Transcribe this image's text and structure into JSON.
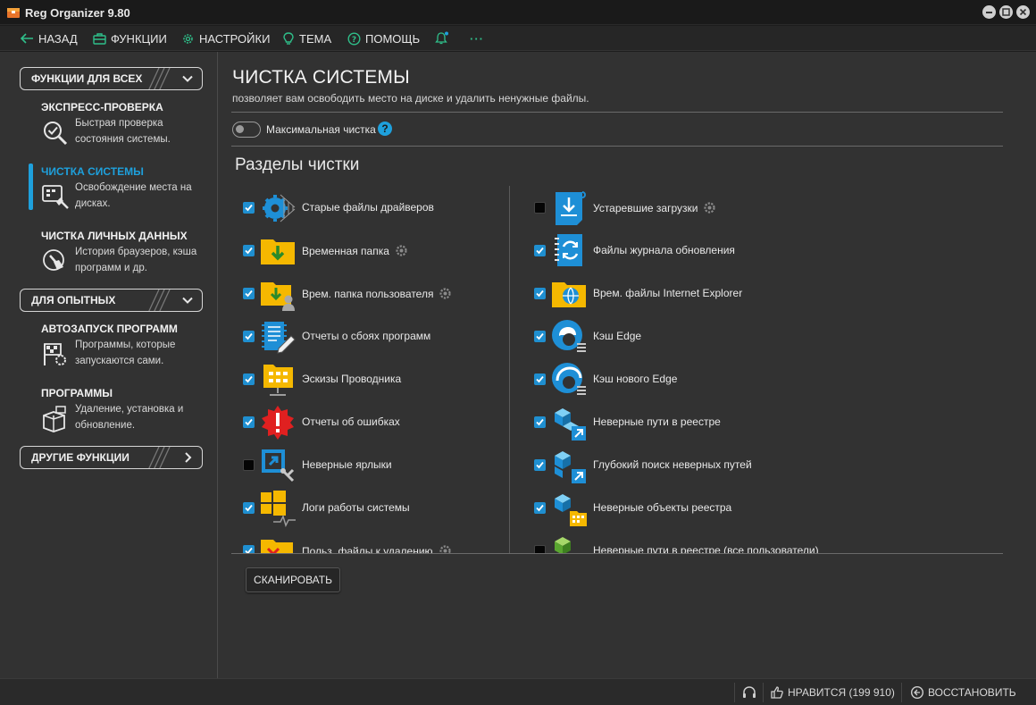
{
  "window": {
    "title": "Reg Organizer 9.80"
  },
  "toolbar": {
    "back": "НАЗАД",
    "functions": "ФУНКЦИИ",
    "settings": "НАСТРОЙКИ",
    "theme": "ТЕМА",
    "help": "ПОМОЩЬ",
    "more": "···"
  },
  "sidebar": {
    "group_all": "ФУНКЦИИ ДЛЯ ВСЕХ",
    "group_advanced": "ДЛЯ ОПЫТНЫХ",
    "group_other": "ДРУГИЕ ФУНКЦИИ",
    "items": [
      {
        "title": "ЭКСПРЕСС-ПРОВЕРКА",
        "desc": "Быстрая проверка состояния системы."
      },
      {
        "title": "ЧИСТКА СИСТЕМЫ",
        "desc": "Освобождение места на дисках."
      },
      {
        "title": "ЧИСТКА ЛИЧНЫХ ДАННЫХ",
        "desc": "История браузеров, кэша программ и др."
      },
      {
        "title": "АВТОЗАПУСК ПРОГРАММ",
        "desc": "Программы, которые запускаются сами."
      },
      {
        "title": "ПРОГРАММЫ",
        "desc": "Удаление, установка и обновление."
      }
    ]
  },
  "content": {
    "title": "ЧИСТКА СИСТЕМЫ",
    "subtitle": "позволяет вам освободить место на диске и удалить ненужные файлы.",
    "max_clean_label": "Максимальная чистка",
    "max_clean_on": false,
    "section_title": "Разделы чистки",
    "left_items": [
      {
        "label": "Старые файлы драйверов",
        "checked": true,
        "gear": false,
        "icon": "driver-gear-icon"
      },
      {
        "label": "Временная папка",
        "checked": true,
        "gear": true,
        "icon": "temp-folder-icon"
      },
      {
        "label": "Врем. папка пользователя",
        "checked": true,
        "gear": true,
        "icon": "user-temp-folder-icon"
      },
      {
        "label": "Отчеты о сбоях программ",
        "checked": true,
        "gear": false,
        "icon": "crash-report-icon"
      },
      {
        "label": "Эскизы Проводника",
        "checked": true,
        "gear": false,
        "icon": "thumbnails-folder-icon"
      },
      {
        "label": "Отчеты об ошибках",
        "checked": true,
        "gear": false,
        "icon": "error-report-icon"
      },
      {
        "label": "Неверные ярлыки",
        "checked": false,
        "gear": false,
        "icon": "broken-shortcut-icon"
      },
      {
        "label": "Логи работы системы",
        "checked": true,
        "gear": false,
        "icon": "windows-logs-icon"
      },
      {
        "label": "Польз. файлы к удалению",
        "checked": true,
        "gear": true,
        "icon": "user-files-delete-icon"
      }
    ],
    "right_items": [
      {
        "label": "Устаревшие загрузки",
        "checked": false,
        "gear": true,
        "icon": "old-downloads-icon"
      },
      {
        "label": "Файлы журнала обновления",
        "checked": true,
        "gear": false,
        "icon": "update-log-icon"
      },
      {
        "label": "Врем. файлы Internet Explorer",
        "checked": true,
        "gear": false,
        "icon": "ie-temp-folder-icon"
      },
      {
        "label": "Кэш Edge",
        "checked": true,
        "gear": false,
        "icon": "edge-cache-icon"
      },
      {
        "label": "Кэш нового Edge",
        "checked": true,
        "gear": false,
        "icon": "new-edge-cache-icon"
      },
      {
        "label": "Неверные пути в реестре",
        "checked": true,
        "gear": false,
        "icon": "registry-paths-icon"
      },
      {
        "label": "Глубокий поиск неверных путей",
        "checked": true,
        "gear": false,
        "icon": "registry-deep-search-icon"
      },
      {
        "label": "Неверные объекты реестра",
        "checked": true,
        "gear": false,
        "icon": "registry-objects-icon"
      },
      {
        "label": "Неверные пути в реестре (все пользователи)",
        "checked": false,
        "gear": false,
        "icon": "registry-all-users-icon"
      }
    ],
    "scan_button": "СКАНИРОВАТЬ"
  },
  "statusbar": {
    "like": "НРАВИТСЯ (199 910)",
    "restore": "ВОССТАНОВИТЬ"
  },
  "colors": {
    "accent": "#1ea0dc",
    "background": "#323232",
    "folder": "#f5b800",
    "toolbar_icon": "#2fbf8a"
  }
}
